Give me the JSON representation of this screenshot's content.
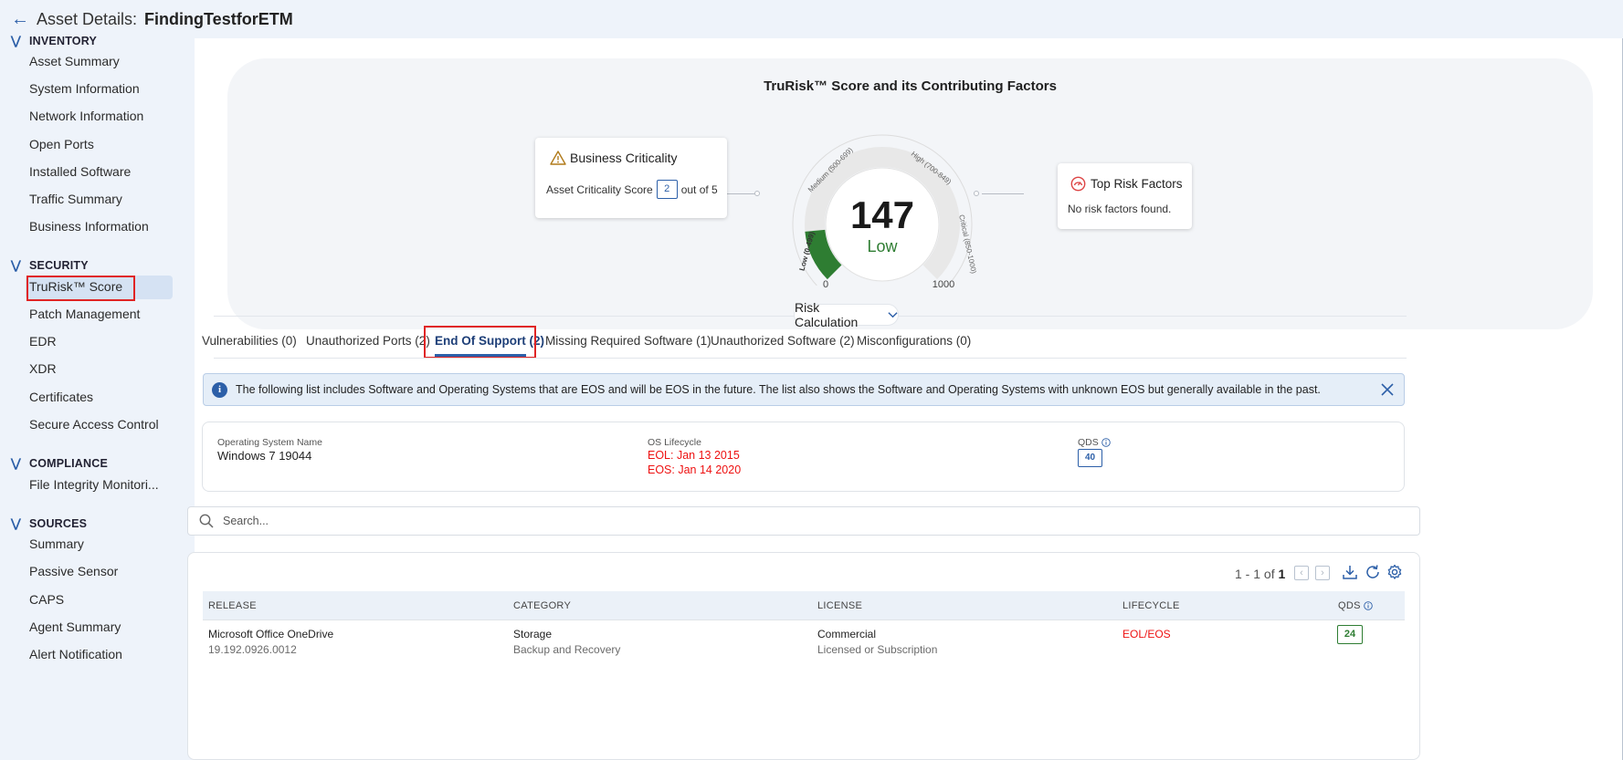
{
  "header": {
    "title_label": "Asset Details:",
    "asset_name": "FindingTestforETM"
  },
  "sidebar": {
    "inventory": {
      "label": "INVENTORY",
      "items": [
        "Asset Summary",
        "System Information",
        "Network Information",
        "Open Ports",
        "Installed Software",
        "Traffic Summary",
        "Business Information"
      ]
    },
    "security": {
      "label": "SECURITY",
      "items": [
        "TruRisk™ Score",
        "Patch Management",
        "EDR",
        "XDR",
        "Certificates",
        "Secure Access Control"
      ],
      "active": "TruRisk™ Score"
    },
    "compliance": {
      "label": "COMPLIANCE",
      "items": [
        "File Integrity Monitori..."
      ]
    },
    "sources": {
      "label": "SOURCES",
      "items": [
        "Summary",
        "Passive Sensor",
        "CAPS",
        "Agent Summary",
        "Alert Notification"
      ]
    }
  },
  "trurisk": {
    "title": "TruRisk™ Score and its Contributing Factors",
    "score": "147",
    "score_value": 147,
    "score_max": 1000,
    "level": "Low",
    "gauge_min": "0",
    "gauge_max": "1000",
    "bands": {
      "low": "Low (0-499)",
      "medium": "Medium (500-699)",
      "high": "High (700-849)",
      "critical": "Critical (850-1000)"
    },
    "colors": {
      "score_fill": "#2e7d32",
      "level_text": "#2e7d32",
      "track": "#e8e8e8"
    },
    "business_criticality": {
      "title": "Business Criticality",
      "label": "Asset Criticality Score",
      "value": "2",
      "suffix": "out of 5"
    },
    "top_risk_factors": {
      "title": "Top Risk Factors",
      "text": "No risk factors found."
    }
  },
  "risk_calculation": {
    "label": "Risk Calculation"
  },
  "tabs": [
    {
      "label": "Vulnerabilities (0)"
    },
    {
      "label": "Unauthorized Ports (2)"
    },
    {
      "label": "End Of Support (2)",
      "active": true
    },
    {
      "label": "Missing Required Software (1)"
    },
    {
      "label": "Unauthorized Software (2)"
    },
    {
      "label": "Misconfigurations (0)"
    }
  ],
  "info_banner": {
    "text": "The following list includes Software and Operating Systems that are EOS and will be EOS in the future. The list also shows the Software and Operating Systems with unknown EOS but generally available in the past."
  },
  "os_summary": {
    "name_label": "Operating System Name",
    "name": "Windows 7 19044",
    "lifecycle_label": "OS Lifecycle",
    "eol": "EOL: Jan 13 2015",
    "eos": "EOS: Jan 14 2020",
    "qds_label": "QDS",
    "qds": "40"
  },
  "search": {
    "placeholder": "Search..."
  },
  "pagination": {
    "range": "1 - 1 of",
    "total": "1"
  },
  "table": {
    "columns": [
      "RELEASE",
      "CATEGORY",
      "LICENSE",
      "LIFECYCLE",
      "QDS"
    ],
    "rows": [
      {
        "release": "Microsoft Office OneDrive",
        "version": "19.192.0926.0012",
        "category": "Storage",
        "subcategory": "Backup and Recovery",
        "license": "Commercial",
        "license_type": "Licensed or Subscription",
        "lifecycle": "EOL/EOS",
        "qds": "24"
      }
    ]
  },
  "icons": [
    "back-arrow-icon",
    "chevron-down-icon",
    "warning-icon",
    "risk-gauge-icon",
    "info-icon",
    "close-icon",
    "search-icon",
    "download-icon",
    "refresh-icon",
    "settings-icon"
  ]
}
